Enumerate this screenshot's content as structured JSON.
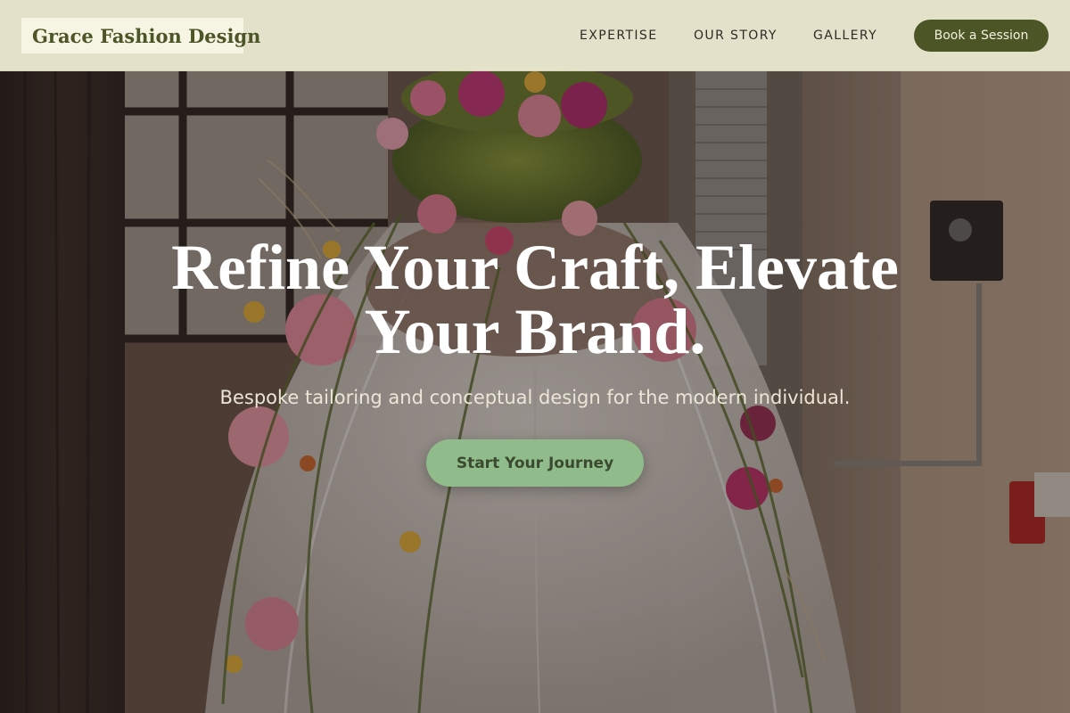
{
  "header": {
    "logo_text": "Grace Fashion Design",
    "nav": [
      {
        "label": "EXPERTISE"
      },
      {
        "label": "OUR STORY"
      },
      {
        "label": "GALLERY"
      }
    ],
    "cta_label": "Book a Session"
  },
  "hero": {
    "headline": "Refine Your Craft, Elevate Your Brand.",
    "tagline": "Bespoke tailoring and conceptual design for the modern individual.",
    "cta_label": "Start Your Journey",
    "background_image": "floral-dress-sculpture"
  },
  "colors": {
    "header_bg": "#eeecd4",
    "brand_olive": "#4b5526",
    "cta_green": "#8fbc8a",
    "nav_text": "#2c2c24"
  }
}
